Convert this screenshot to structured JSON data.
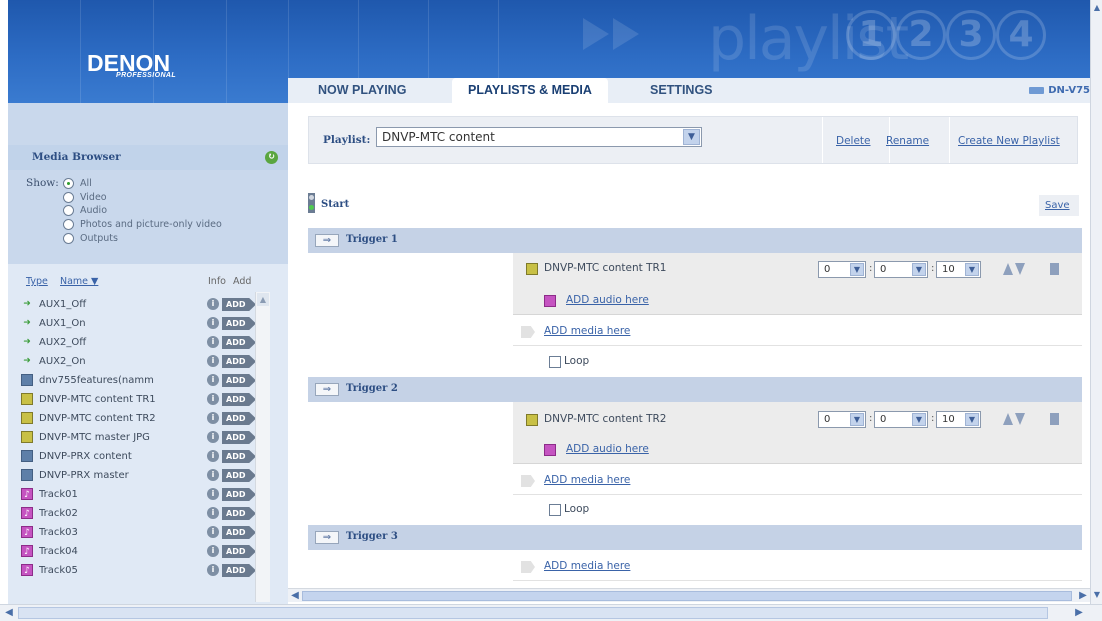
{
  "header": {
    "brand": "DENON",
    "brand_sub": "PROFESSIONAL",
    "watermark": "playlist",
    "numbers": [
      "1",
      "2",
      "3",
      "4"
    ],
    "device": "DN-V75"
  },
  "tabs": [
    {
      "label": "NOW PLAYING",
      "active": false
    },
    {
      "label": "PLAYLISTS & MEDIA",
      "active": true
    },
    {
      "label": "SETTINGS",
      "active": false
    }
  ],
  "sidebar": {
    "title": "Media Browser",
    "refresh_icon": "refresh-icon",
    "show_label": "Show:",
    "filters": [
      {
        "label": "All",
        "selected": true
      },
      {
        "label": "Video",
        "selected": false
      },
      {
        "label": "Audio",
        "selected": false
      },
      {
        "label": "Photos and picture-only video",
        "selected": false
      },
      {
        "label": "Outputs",
        "selected": false
      }
    ],
    "columns": {
      "type": "Type",
      "name": "Name ▼",
      "info": "Info",
      "add": "Add"
    },
    "add_label": "ADD",
    "items": [
      {
        "type": "output",
        "name": "AUX1_Off"
      },
      {
        "type": "output",
        "name": "AUX1_On"
      },
      {
        "type": "output",
        "name": "AUX2_Off"
      },
      {
        "type": "output",
        "name": "AUX2_On"
      },
      {
        "type": "video",
        "name": "dnv755features(namm"
      },
      {
        "type": "photo",
        "name": "DNVP-MTC content TR1"
      },
      {
        "type": "photo",
        "name": "DNVP-MTC content TR2"
      },
      {
        "type": "photo",
        "name": "DNVP-MTC master JPG"
      },
      {
        "type": "video",
        "name": "DNVP-PRX content"
      },
      {
        "type": "video",
        "name": "DNVP-PRX master"
      },
      {
        "type": "audio",
        "name": "Track01"
      },
      {
        "type": "audio",
        "name": "Track02"
      },
      {
        "type": "audio",
        "name": "Track03"
      },
      {
        "type": "audio",
        "name": "Track04"
      },
      {
        "type": "audio",
        "name": "Track05"
      }
    ]
  },
  "playlist": {
    "label": "Playlist:",
    "selected": "DNVP-MTC content",
    "actions": {
      "delete": "Delete",
      "rename": "Rename",
      "create": "Create New Playlist"
    },
    "start_label": "Start",
    "save_label": "Save",
    "loop_label": "Loop",
    "add_audio": "ADD audio here",
    "add_media": "ADD media here",
    "triggers": [
      {
        "label": "Trigger 1",
        "item": "DNVP-MTC content TR1",
        "h": "0",
        "m": "0",
        "s": "10"
      },
      {
        "label": "Trigger 2",
        "item": "DNVP-MTC content TR2",
        "h": "0",
        "m": "0",
        "s": "10"
      },
      {
        "label": "Trigger 3"
      }
    ]
  },
  "colors": {
    "banner": "#2d6cc4",
    "sidebar": "#e0e9f5",
    "link": "#3a63a8",
    "trigger_bar": "#c5d2e6"
  }
}
